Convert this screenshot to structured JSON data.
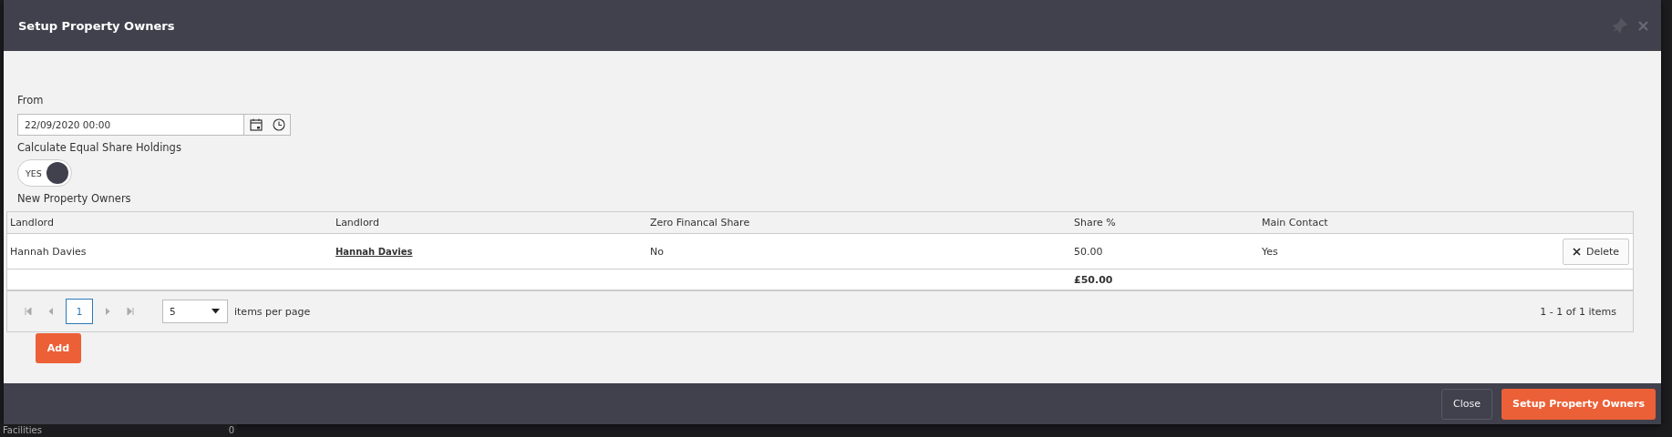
{
  "window": {
    "title": "Setup Property Owners"
  },
  "form": {
    "from_label": "From",
    "from_value": "22/09/2020 00:00",
    "equal_share_label": "Calculate Equal Share Holdings",
    "equal_share_toggle": {
      "label": "YES",
      "on": true
    },
    "owners_label": "New Property Owners"
  },
  "table": {
    "columns": [
      "Landlord",
      "Landlord",
      "Zero Financal Share",
      "Share %",
      "Main Contact"
    ],
    "rows": [
      {
        "landlord": "Hannah Davies",
        "landlord_link": "Hannah Davies",
        "zero_financial_share": "No",
        "share": "50.00",
        "main_contact": "Yes",
        "action": "Delete"
      }
    ],
    "total": "£50.00",
    "pager": {
      "pages": [
        {
          "label": "1",
          "selected": true
        }
      ],
      "page_size": "5",
      "page_size_label": "items per page",
      "summary": "1 - 1 of 1 items"
    }
  },
  "add_button": "Add",
  "buttons": [
    {
      "label": "Close",
      "kind": "secondary"
    },
    {
      "label": "Setup Property Owners",
      "kind": "primary"
    }
  ],
  "background": {
    "item": "Facilities",
    "count": "0"
  }
}
